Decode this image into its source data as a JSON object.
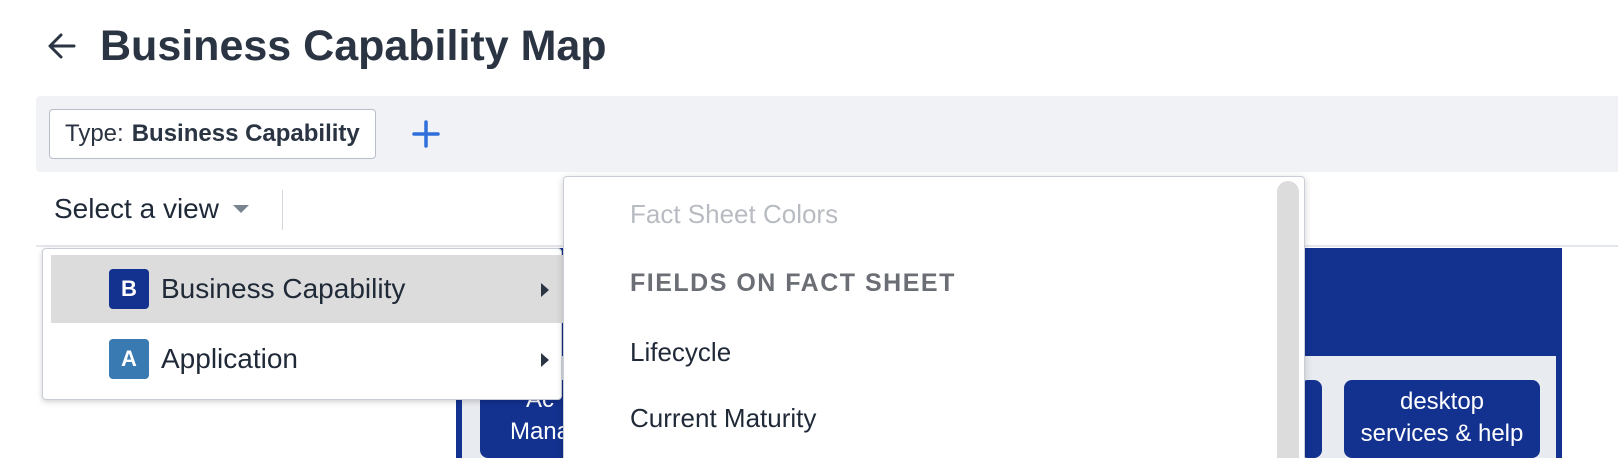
{
  "header": {
    "back_icon": "arrow-left-icon",
    "title": "Business Capability Map"
  },
  "filter_bar": {
    "chip_label": "Type:",
    "chip_value": "Business Capability",
    "add_icon": "plus-icon",
    "accent_color": "#2f6fdb"
  },
  "toolbar": {
    "view_select_label": "Select a view",
    "caret_icon": "caret-down-icon"
  },
  "menu_primary": {
    "items": [
      {
        "badge": "B",
        "label": "Business Capability",
        "badge_color": "#13318f",
        "active": true,
        "arrow_icon": "caret-right-icon"
      },
      {
        "badge": "A",
        "label": "Application",
        "badge_color": "#3a7ab3",
        "active": false,
        "arrow_icon": "caret-right-icon"
      }
    ]
  },
  "menu_secondary": {
    "disabled_item": "Fact Sheet Colors",
    "section_header": "FIELDS ON FACT SHEET",
    "items": [
      "Lifecycle",
      "Current Maturity"
    ]
  },
  "map": {
    "header_color": "#13318f",
    "capabilities": [
      {
        "text_line1": "Ac",
        "text_line2": "Mana"
      },
      {
        "text_line1": "desktop",
        "text_line2": "services & help"
      }
    ]
  }
}
